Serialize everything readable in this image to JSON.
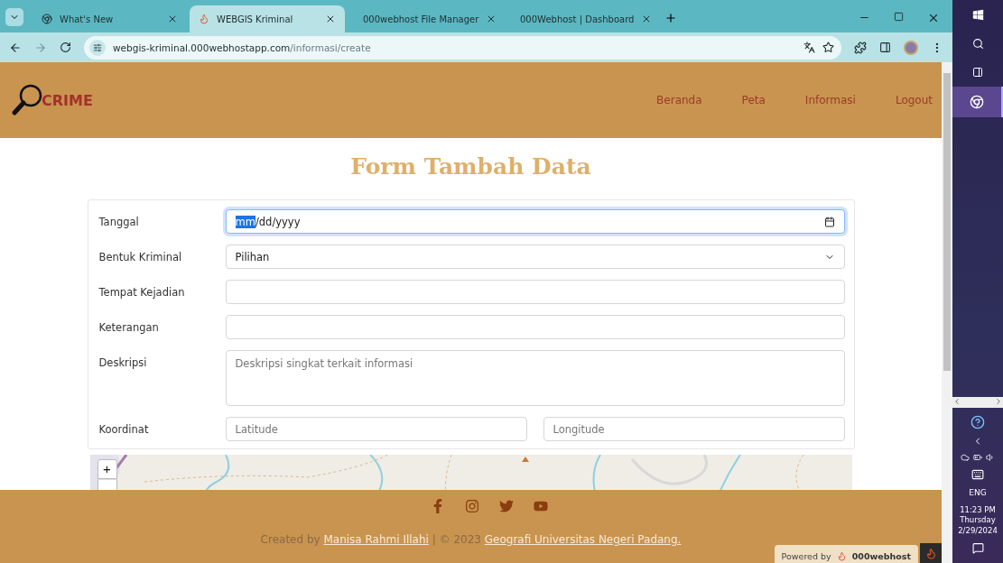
{
  "browser": {
    "tabs": [
      {
        "title": "What's New",
        "selected": false
      },
      {
        "title": "WEBGIS Kriminal",
        "selected": true
      },
      {
        "title": "000webhost File Manager",
        "selected": false
      },
      {
        "title": "000Webhost | Dashboard",
        "selected": false
      }
    ],
    "address": {
      "host": "webgis-kriminal.000webhostapp.com",
      "path": "/informasi/create"
    }
  },
  "navbar": {
    "brand": "CRIME",
    "links": [
      {
        "label": "Beranda"
      },
      {
        "label": "Peta"
      },
      {
        "label": "Informasi"
      },
      {
        "label": "Logout"
      }
    ]
  },
  "form": {
    "title": "Form Tambah Data",
    "rows": [
      {
        "kind": "date",
        "label": "Tanggal",
        "focused": true,
        "value_parts": [
          {
            "text": "mm",
            "selected": true
          },
          {
            "text": "/dd/yyyy",
            "selected": false
          }
        ]
      },
      {
        "kind": "select",
        "label": "Bentuk Kriminal",
        "value": "Pilihan"
      },
      {
        "kind": "text",
        "label": "Tempat Kejadian"
      },
      {
        "kind": "text",
        "label": "Keterangan"
      },
      {
        "kind": "textarea",
        "label": "Deskripsi",
        "placeholder": "Deskripsi singkat terkait informasi"
      },
      {
        "kind": "coords",
        "label": "Koordinat",
        "placeholders": [
          "Latitude",
          "Longitude"
        ]
      }
    ]
  },
  "map": {
    "zoom_in": "+"
  },
  "footer": {
    "prefix": "Created by ",
    "author": "Manisa Rahmi Illahi",
    "middle": " | © 2023 ",
    "institution": "Geografi Universitas Negeri Padang.",
    "powered_by": "Powered by",
    "host_brand": "000webhost"
  },
  "taskbar": {
    "language": "ENG",
    "time": "11:23 PM",
    "day": "Thursday",
    "date": "2/29/2024"
  }
}
